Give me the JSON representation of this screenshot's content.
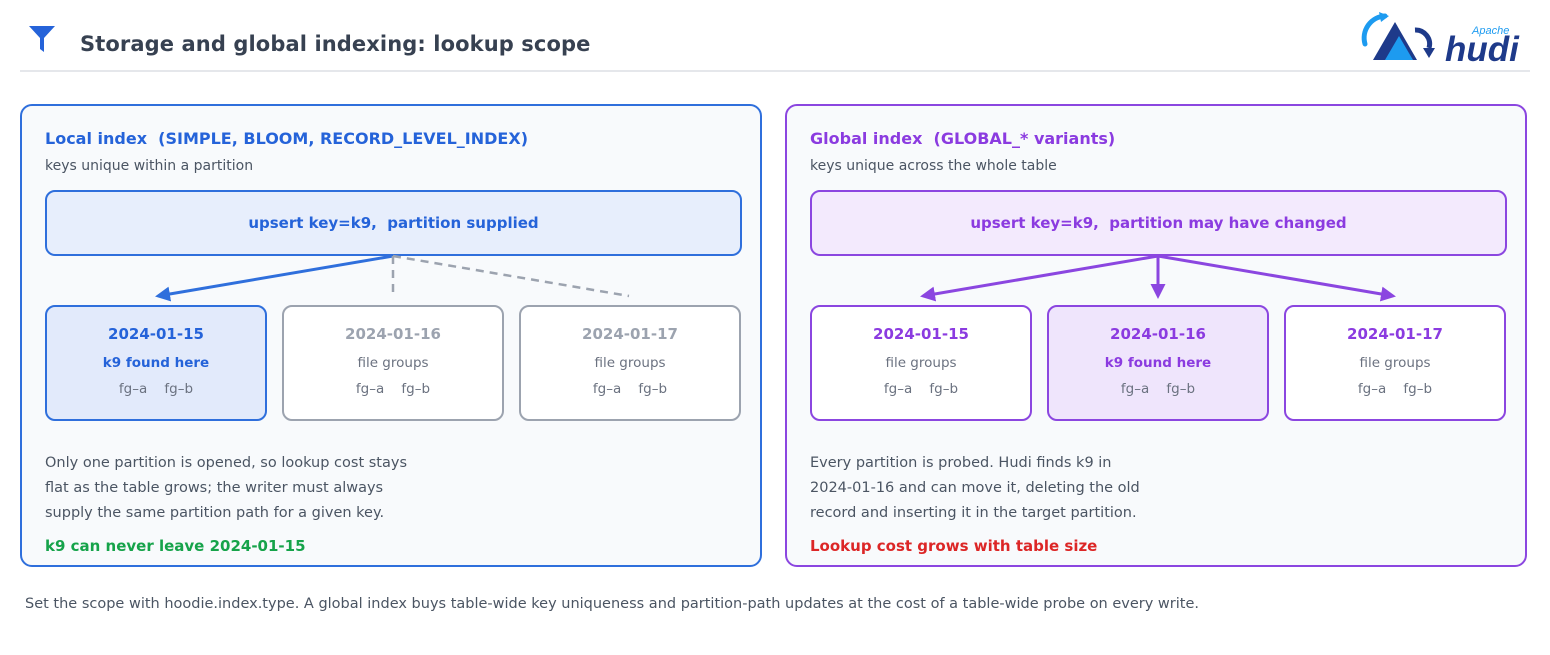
{
  "header": {
    "title": "Storage and global indexing: lookup scope",
    "logo": {
      "small_text": "Apache",
      "wordmark": "hudi"
    }
  },
  "local": {
    "title": "Local index  (SIMPLE, BLOOM, RECORD_LEVEL_INDEX)",
    "subtitle": "keys unique within a partition",
    "upsert": "upsert key=k9,  partition supplied",
    "partitions": [
      {
        "date": "2024-01-15",
        "note": "k9 found here",
        "fgs": "fg–a    fg–b"
      },
      {
        "date": "2024-01-16",
        "note": "file groups",
        "fgs": "fg–a    fg–b"
      },
      {
        "date": "2024-01-17",
        "note": "file groups",
        "fgs": "fg–a    fg–b"
      }
    ],
    "desc": [
      "Only one partition is opened, so lookup cost stays",
      "flat as the table grows; the writer must always",
      "supply the same partition path for a given key."
    ],
    "verdict": "k9 can never leave 2024-01-15"
  },
  "global": {
    "title": "Global index  (GLOBAL_* variants)",
    "subtitle": "keys unique across the whole table",
    "upsert": "upsert key=k9,  partition may have changed",
    "partitions": [
      {
        "date": "2024-01-15",
        "note": "file groups",
        "fgs": "fg–a    fg–b"
      },
      {
        "date": "2024-01-16",
        "note": "k9 found here",
        "fgs": "fg–a    fg–b"
      },
      {
        "date": "2024-01-17",
        "note": "file groups",
        "fgs": "fg–a    fg–b"
      }
    ],
    "desc": [
      "Every partition is probed. Hudi finds k9 in",
      "2024-01-16 and can move it, deleting the old",
      "record and inserting it in the target partition."
    ],
    "verdict": "Lookup cost grows with table size"
  },
  "footer": "Set the scope with hoodie.index.type. A global index buys table-wide key uniqueness and partition-path updates at the cost of a table-wide probe on every write.",
  "colors": {
    "local_accent": "#2f6fdc",
    "global_accent": "#8b46e0",
    "muted_gray": "#9ca3af",
    "good_green": "#16a34a",
    "bad_red": "#dc2626",
    "logo_blue": "#1d9bf0",
    "logo_navy": "#1e3a8a"
  },
  "icons": [
    "filter-icon",
    "hudi-logo"
  ]
}
